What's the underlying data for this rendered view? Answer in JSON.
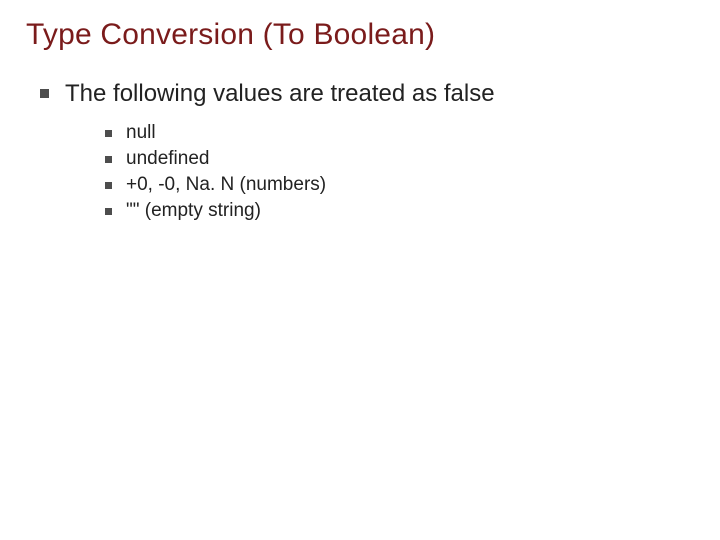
{
  "title": "Type Conversion (To Boolean)",
  "main": {
    "text": "The following values are treated as false"
  },
  "sub": [
    {
      "text": "null"
    },
    {
      "text": "undefined"
    },
    {
      "text": "+0, -0, Na. N (numbers)"
    },
    {
      "text": "\"\" (empty string)"
    }
  ]
}
